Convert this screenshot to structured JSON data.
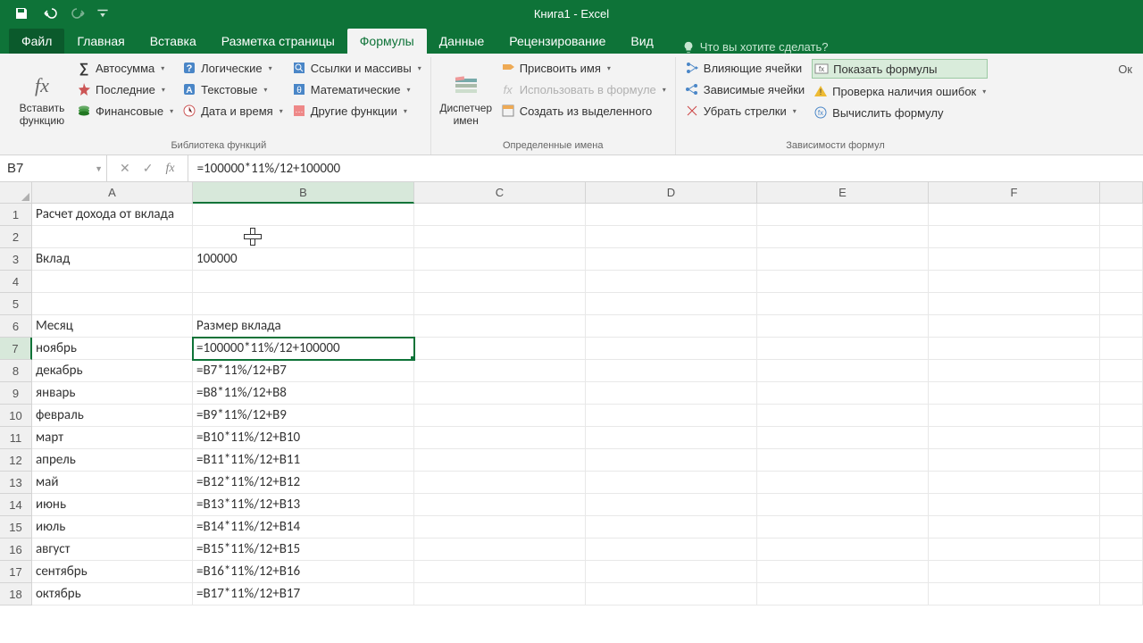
{
  "title": "Книга1 - Excel",
  "tabs": {
    "file": "Файл",
    "home": "Главная",
    "insert": "Вставка",
    "layout": "Разметка страницы",
    "formulas": "Формулы",
    "data": "Данные",
    "review": "Рецензирование",
    "view": "Вид"
  },
  "tellme": "Что вы хотите сделать?",
  "ribbon": {
    "insert_fn": "Вставить функцию",
    "autosum": "Автосумма",
    "recent": "Последние",
    "financial": "Финансовые",
    "logical": "Логические",
    "text": "Текстовые",
    "datetime": "Дата и время",
    "lookup": "Ссылки и массивы",
    "math": "Математические",
    "more": "Другие функции",
    "lib_label": "Библиотека функций",
    "name_mgr": "Диспетчер имен",
    "define_name": "Присвоить имя",
    "use_formula": "Использовать в формуле",
    "create_sel": "Создать из выделенного",
    "names_label": "Определенные имена",
    "trace_prec": "Влияющие ячейки",
    "trace_dep": "Зависимые ячейки",
    "remove_arr": "Убрать стрелки",
    "show_formulas": "Показать формулы",
    "error_check": "Проверка наличия ошибок",
    "eval_formula": "Вычислить формулу",
    "audit_label": "Зависимости формул",
    "ok": "Ок"
  },
  "namebox": "B7",
  "formula": "=100000*11%/12+100000",
  "columns": [
    "A",
    "B",
    "C",
    "D",
    "E",
    "F"
  ],
  "active_col": "B",
  "active_row": 7,
  "cells": {
    "A1": "Расчет дохода от вклада",
    "A3": "Вклад",
    "B3": "100000",
    "A6": "Месяц",
    "B6": "Размер вклада",
    "A7": "ноябрь",
    "B7": "=100000*11%/12+100000",
    "A8": "декабрь",
    "B8": "=B7*11%/12+B7",
    "A9": "январь",
    "B9": "=B8*11%/12+B8",
    "A10": "февраль",
    "B10": "=B9*11%/12+B9",
    "A11": "март",
    "B11": "=B10*11%/12+B10",
    "A12": "апрель",
    "B12": "=B11*11%/12+B11",
    "A13": "май",
    "B13": "=B12*11%/12+B12",
    "A14": "июнь",
    "B14": "=B13*11%/12+B13",
    "A15": "июль",
    "B15": "=B14*11%/12+B14",
    "A16": "август",
    "B16": "=B15*11%/12+B15",
    "A17": "сентябрь",
    "B17": "=B16*11%/12+B16",
    "A18": "октябрь",
    "B18": "=B17*11%/12+B17"
  },
  "rowcount": 18
}
